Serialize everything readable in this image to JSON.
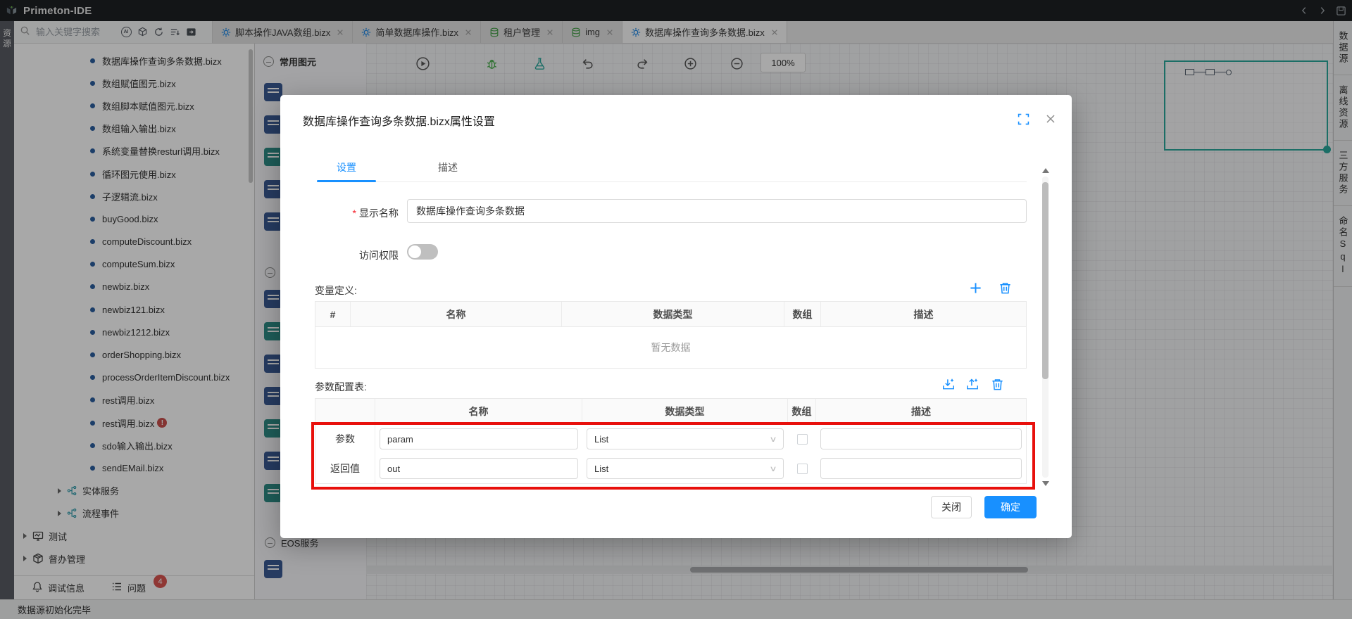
{
  "window": {
    "title": "Primeton-IDE"
  },
  "search": {
    "placeholder": "输入关键字搜索"
  },
  "icons_text": {
    "ai": "AI"
  },
  "left_strip": {
    "label": "资源"
  },
  "editor_tabs": [
    {
      "label": "脚本操作JAVA数组.bizx",
      "icon": "gear",
      "active": false
    },
    {
      "label": "简单数据库操作.bizx",
      "icon": "gear",
      "active": false
    },
    {
      "label": "租户管理",
      "icon": "database",
      "active": false
    },
    {
      "label": "img",
      "icon": "database",
      "active": false
    },
    {
      "label": "数据库操作查询多条数据.bizx",
      "icon": "gear",
      "active": true
    }
  ],
  "tree": {
    "files": [
      {
        "label": "数据库操作查询多条数据.bizx"
      },
      {
        "label": "数组赋值图元.bizx"
      },
      {
        "label": "数组脚本赋值图元.bizx"
      },
      {
        "label": "数组输入输出.bizx"
      },
      {
        "label": "系统变量替换resturl调用.bizx"
      },
      {
        "label": "循环图元使用.bizx"
      },
      {
        "label": "子逻辑流.bizx"
      },
      {
        "label": "buyGood.bizx"
      },
      {
        "label": "computeDiscount.bizx"
      },
      {
        "label": "computeSum.bizx"
      },
      {
        "label": "newbiz.bizx"
      },
      {
        "label": "newbiz121.bizx"
      },
      {
        "label": "newbiz1212.bizx"
      },
      {
        "label": "orderShopping.bizx"
      },
      {
        "label": "processOrderItemDiscount.bizx"
      },
      {
        "label": "rest调用.bizx"
      },
      {
        "label": "rest调用.bizx",
        "error": true
      },
      {
        "label": "sdo输入输出.bizx"
      },
      {
        "label": "sendEMail.bizx"
      }
    ],
    "service_nodes": [
      {
        "label": "实体服务"
      },
      {
        "label": "流程事件"
      }
    ],
    "root_nodes": [
      {
        "label": "测试"
      },
      {
        "label": "督办管理"
      }
    ]
  },
  "bottom_tabs": {
    "debug_label": "调试信息",
    "problems_label": "问题",
    "problems_count": "4"
  },
  "palette": {
    "header": "常用图元",
    "group_footer": "EOS服务"
  },
  "canvas": {
    "zoom_level": "100%"
  },
  "right_strip": {
    "tabs": [
      "数据源",
      "离线资源",
      "三方服务",
      "命名Sql"
    ]
  },
  "statusbar": {
    "text": "数据源初始化完毕"
  },
  "modal": {
    "title": "数据库操作查询多条数据.bizx属性设置",
    "tabs": [
      {
        "label": "设置",
        "active": true
      },
      {
        "label": "描述",
        "active": false
      }
    ],
    "fields": {
      "display_name_label": "显示名称",
      "display_name_value": "数据库操作查询多条数据",
      "access_label": "访问权限",
      "access_on": false
    },
    "variables": {
      "label": "变量定义:",
      "columns": [
        "#",
        "名称",
        "数据类型",
        "数组",
        "描述"
      ],
      "empty_text": "暂无数据"
    },
    "params": {
      "label": "参数配置表:",
      "columns": [
        "",
        "名称",
        "数据类型",
        "数组",
        "描述"
      ],
      "rows": [
        {
          "row_label": "参数",
          "name": "param",
          "type": "List",
          "array_checked": false,
          "desc": ""
        },
        {
          "row_label": "返回值",
          "name": "out",
          "type": "List",
          "array_checked": false,
          "desc": ""
        }
      ]
    },
    "footer": {
      "close": "关闭",
      "ok": "确定"
    }
  },
  "colors": {
    "accent": "#1890ff",
    "annotation_red": "#e8100c",
    "gear_icon_blue": "#1e88e5",
    "database_icon_green": "#43a047",
    "error_badge_red": "#c9504c",
    "problems_badge_red": "#d9544f"
  }
}
